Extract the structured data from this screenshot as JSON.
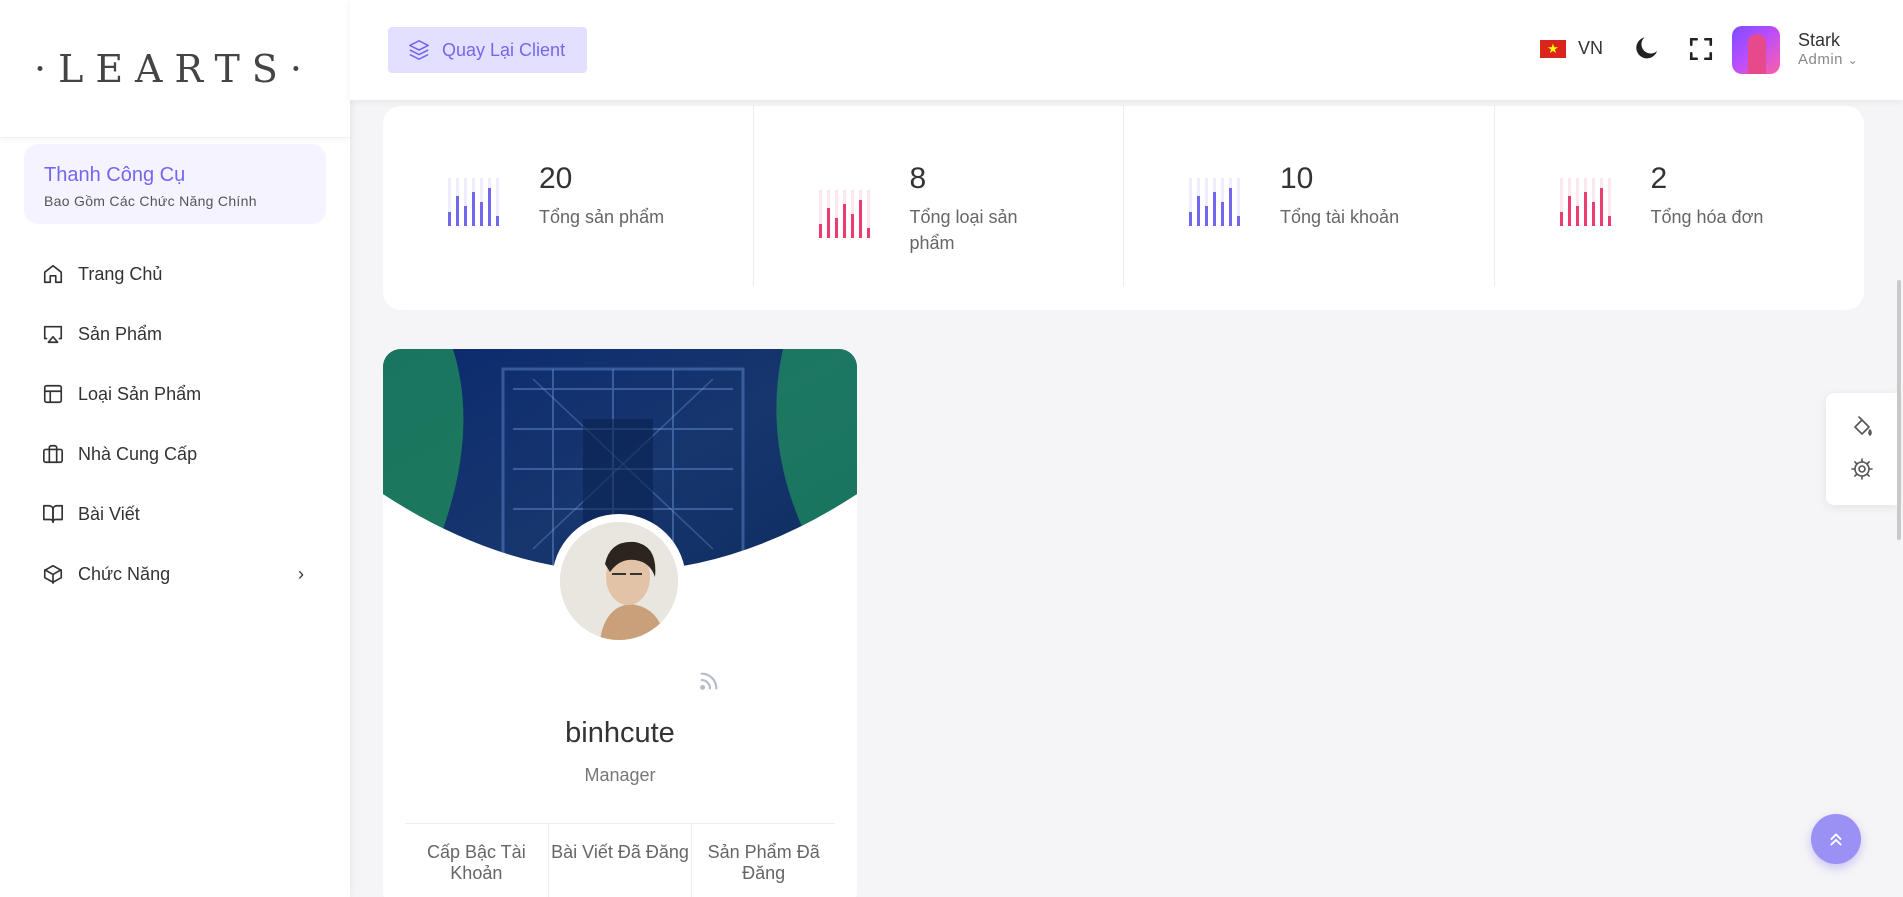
{
  "sidebar": {
    "logo": "·LEARTS·",
    "toolbar_title": "Thanh Công Cụ",
    "toolbar_subtitle": "Bao Gồm Các Chức Năng Chính",
    "items": [
      {
        "label": "Trang Chủ",
        "icon": "home-icon"
      },
      {
        "label": "Sản Phẩm",
        "icon": "monitor-icon"
      },
      {
        "label": "Loại Sản Phẩm",
        "icon": "layout-icon"
      },
      {
        "label": "Nhà Cung Cấp",
        "icon": "briefcase-icon"
      },
      {
        "label": "Bài Viết",
        "icon": "book-icon"
      },
      {
        "label": "Chức Năng",
        "icon": "box-icon"
      }
    ]
  },
  "header": {
    "back_label": "Quay Lại Client",
    "language": "VN",
    "user_name": "Stark",
    "user_role": "Admin"
  },
  "stats": [
    {
      "value": "20",
      "label": "Tổng sản phẩm",
      "color": "#7367f0"
    },
    {
      "value": "8",
      "label": "Tổng loại sản phẩm",
      "color": "#ea3c6e"
    },
    {
      "value": "10",
      "label": "Tổng tài khoản",
      "color": "#7367f0"
    },
    {
      "value": "2",
      "label": "Tổng hóa đơn",
      "color": "#ea3c6e"
    }
  ],
  "profile": {
    "name": "binhcute",
    "role": "Manager",
    "stat_labels": [
      "Cấp Bậc Tài Khoản",
      "Bài Viết Đã Đăng",
      "Sản Phẩm Đã Đăng"
    ]
  },
  "colors": {
    "primary": "#7367f0",
    "pink": "#ea3c6e"
  }
}
